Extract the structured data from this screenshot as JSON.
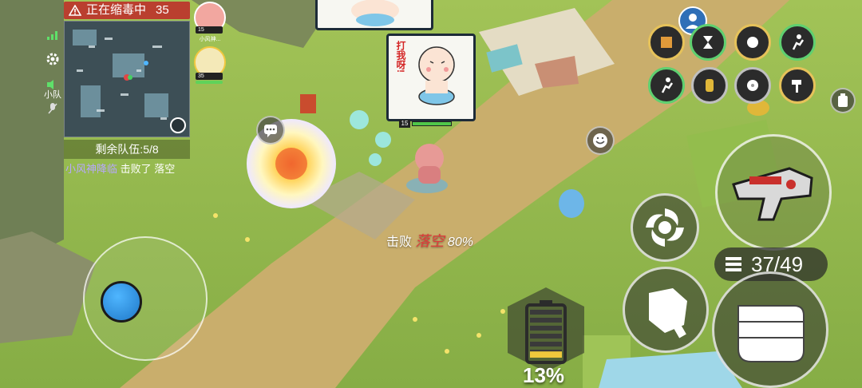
{
  "status": {
    "poison_label": "正在缩毒中",
    "poison_countdown": "35"
  },
  "squad": {
    "label": "小队",
    "mates": [
      {
        "level": "15",
        "name": "小风神..."
      },
      {
        "level": "35",
        "name": ""
      }
    ]
  },
  "match": {
    "teams_remaining": "剩余队伍:5/8"
  },
  "kill_feed": {
    "killer": "小风神降临",
    "verb": "击败了",
    "victim": "落空"
  },
  "player": {
    "level": "15"
  },
  "kill_notice": {
    "verb": "击败",
    "victim": "落空",
    "percent": "80%"
  },
  "sticker": {
    "text": "打我呀!"
  },
  "weapon": {
    "ammo": "37/49"
  },
  "shield": {
    "percent": "13%",
    "fill_fraction": 0.13
  },
  "colors": {
    "accent_red": "#e03a3a",
    "hp_green": "#4fc74a",
    "skill_gold": "#e6c25a",
    "skill_green": "#5fd070"
  },
  "icons": {
    "poison_alert": "warning-triangle-icon",
    "signal": "signal-icon",
    "settings": "gear-icon",
    "voice": "speaker-icon",
    "mic": "mic-icon",
    "chat": "chat-bubble-icon",
    "emote": "emote-face-icon",
    "zoom": "zoom-in-icon",
    "dash": "spin-dash-icon",
    "melee": "wrench-hand-icon",
    "fire": "fist-icon",
    "weapon": "ray-gun-icon"
  }
}
